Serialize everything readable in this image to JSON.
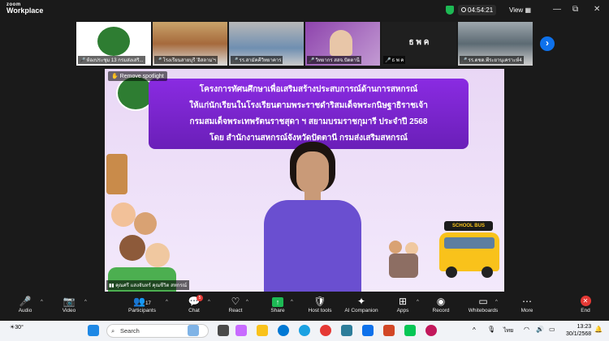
{
  "app": {
    "brand_line1": "zoom",
    "brand_line2": "Workplace"
  },
  "titlebar": {
    "timer": "04:54:21",
    "view_label": "View",
    "minimize": "—",
    "restore": "⧉",
    "close": "✕"
  },
  "participants_strip": [
    {
      "label": "ห้องประชุม 13 กรมส่งเสริ..."
    },
    {
      "label": "โรงเรียนสายบุรี 'อิสลาม'ฯ"
    },
    {
      "label": "รร.สามัคคีวิทยาคาร"
    },
    {
      "label": "วิทยากร สสจ.ปัตตานี"
    },
    {
      "label": "ธ พ ค",
      "center_text": "ธ พ ค"
    },
    {
      "label": "รร.ตชด.พีระยานุเคราะห์4"
    }
  ],
  "spotlight": {
    "remove_label": "Remove spotlight",
    "speaker_label": "คุณศรี แสงจันทร์ คุณชีวิต สหกรณ์"
  },
  "banner": {
    "lines": [
      "โครงการทัศนศึกษาเพื่อเสริมสร้างประสบการณ์ด้านการสหกรณ์",
      "ให้แก่นักเรียนในโรงเรียนตามพระราชดำริสมเด็จพระกนิษฐาธิราชเจ้า",
      "กรมสมเด็จพระเทพรัตนราชสุดา ฯ สยามบรมราชกุมารี ประจำปี 2568",
      "โดย สำนักงานสหกรณ์จังหวัดปัตตานี กรมส่งเสริมสหกรณ์"
    ]
  },
  "bus_sign": "SCHOOL BUS",
  "toolbar": {
    "audio": "Audio",
    "video": "Video",
    "participants": "Participants",
    "participants_count": "17",
    "chat": "Chat",
    "chat_badge": "5",
    "react": "React",
    "share": "Share",
    "host_tools": "Host tools",
    "ai_companion": "AI Companion",
    "apps": "Apps",
    "record": "Record",
    "whiteboards": "Whiteboards",
    "more": "More",
    "end": "End"
  },
  "taskbar": {
    "weather": "30°",
    "search_placeholder": "Search",
    "lang": "ไทย",
    "time": "13:23",
    "date": "30/1/2568"
  },
  "colors": {
    "accent": "#0e71eb",
    "end_red": "#e53935",
    "banner_purple": "#7a22cc",
    "shield_green": "#1db954"
  }
}
